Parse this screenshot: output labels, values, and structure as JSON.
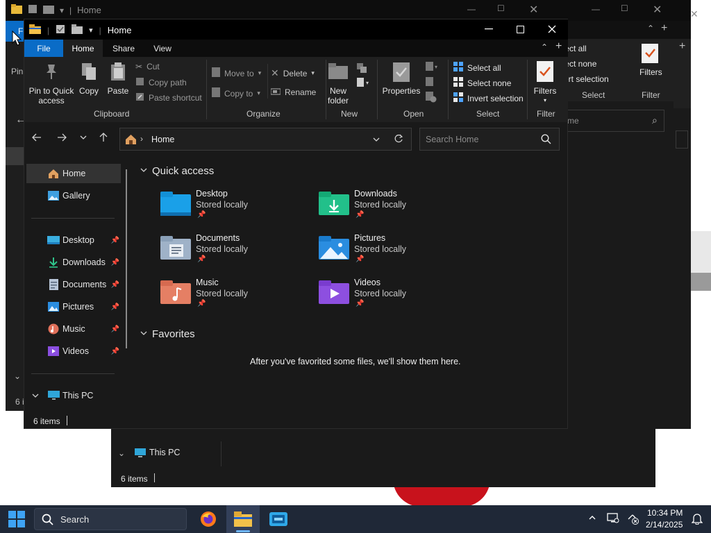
{
  "back_window": {
    "title": "Home",
    "ribbon": {
      "select_all": "Select all",
      "select_none": "Select none",
      "invert_selection": "Invert selection",
      "select_group": "Select",
      "filters": "Filters",
      "filter_group": "Filter"
    },
    "search_placeholder": "me",
    "pin_label": "Pin",
    "file_label": "F",
    "items_count": "6 i"
  },
  "lower_window": {
    "this_pc": "This PC",
    "status": "6 items"
  },
  "main_window": {
    "title": "Home",
    "tabs": [
      "File",
      "Home",
      "Share",
      "View"
    ],
    "ribbon": {
      "clipboard": {
        "pin": "Pin to Quick access",
        "pin_l1": "Pin to Quick",
        "pin_l2": "access",
        "copy": "Copy",
        "paste": "Paste",
        "cut": "Cut",
        "copy_path": "Copy path",
        "paste_shortcut": "Paste shortcut",
        "group": "Clipboard"
      },
      "organize": {
        "move_to": "Move to",
        "copy_to": "Copy to",
        "delete": "Delete",
        "rename": "Rename",
        "group": "Organize"
      },
      "new": {
        "new_folder_l1": "New",
        "new_folder_l2": "folder",
        "group": "New"
      },
      "open": {
        "properties": "Properties",
        "group": "Open"
      },
      "select": {
        "select_all": "Select all",
        "select_none": "Select none",
        "invert_selection": "Invert selection",
        "group": "Select"
      },
      "filter": {
        "filters": "Filters",
        "group": "Filter"
      }
    },
    "address": {
      "crumb": "Home",
      "search_placeholder": "Search Home"
    },
    "nav": [
      {
        "label": "Home",
        "icon": "home-icon"
      },
      {
        "label": "Gallery",
        "icon": "gallery-icon"
      },
      {
        "label": "Desktop",
        "icon": "desktop-icon"
      },
      {
        "label": "Downloads",
        "icon": "downloads-icon"
      },
      {
        "label": "Documents",
        "icon": "documents-icon"
      },
      {
        "label": "Pictures",
        "icon": "pictures-icon"
      },
      {
        "label": "Music",
        "icon": "music-icon"
      },
      {
        "label": "Videos",
        "icon": "videos-icon"
      },
      {
        "label": "This PC",
        "icon": "this-pc-icon"
      }
    ],
    "quick_access": {
      "title": "Quick access",
      "items": [
        {
          "name": "Desktop",
          "status": "Stored locally"
        },
        {
          "name": "Downloads",
          "status": "Stored locally"
        },
        {
          "name": "Documents",
          "status": "Stored locally"
        },
        {
          "name": "Pictures",
          "status": "Stored locally"
        },
        {
          "name": "Music",
          "status": "Stored locally"
        },
        {
          "name": "Videos",
          "status": "Stored locally"
        }
      ]
    },
    "favorites": {
      "title": "Favorites",
      "empty_message": "After you've favorited some files, we'll show them here."
    },
    "status": "6 items"
  },
  "taskbar": {
    "search_label": "Search",
    "time": "10:34 PM",
    "date": "2/14/2025"
  },
  "colors": {
    "accent": "#0a6cc7",
    "window_bg": "#191919",
    "titlebar_bg": "#000000",
    "taskbar_bg": "#1f2837"
  }
}
